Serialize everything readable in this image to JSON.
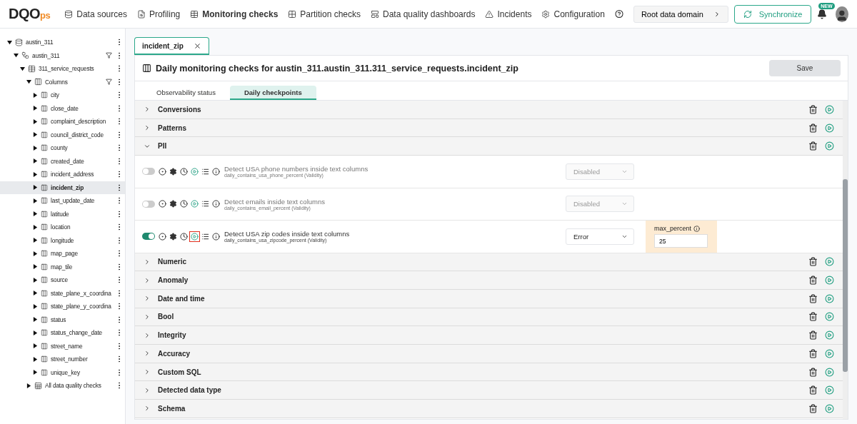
{
  "logo": {
    "main": "DQO",
    "suffix": "ps"
  },
  "nav": [
    {
      "label": "Data sources",
      "kind": "sources",
      "selected": false
    },
    {
      "label": "Profiling",
      "kind": "profiling",
      "selected": false
    },
    {
      "label": "Monitoring checks",
      "kind": "monitoring",
      "selected": true
    },
    {
      "label": "Partition checks",
      "kind": "partition",
      "selected": false
    },
    {
      "label": "Data quality dashboards",
      "kind": "dashboards",
      "selected": false
    },
    {
      "label": "Incidents",
      "kind": "incidents",
      "selected": false
    },
    {
      "label": "Configuration",
      "kind": "configuration",
      "selected": false
    }
  ],
  "header_right": {
    "domain_button": "Root data domain",
    "sync_button": "Synchronize",
    "badge": "NEW"
  },
  "tree": [
    {
      "label": "austin_311",
      "kind": "database",
      "expanded": true,
      "selected": false,
      "children": [
        {
          "label": "austin_311",
          "kind": "schema",
          "expanded": true,
          "selected": false,
          "children": [
            {
              "label": "311_service_requests",
              "kind": "table",
              "expanded": true,
              "selected": false,
              "children": [
                {
                  "label": "Columns",
                  "kind": "columns",
                  "expanded": true,
                  "selected": false,
                  "children": [
                    {
                      "label": "city",
                      "kind": "column",
                      "expanded": false,
                      "selected": false
                    },
                    {
                      "label": "close_date",
                      "kind": "column",
                      "expanded": false,
                      "selected": false
                    },
                    {
                      "label": "complaint_description",
                      "kind": "column",
                      "expanded": false,
                      "selected": false
                    },
                    {
                      "label": "council_district_code",
                      "kind": "column",
                      "expanded": false,
                      "selected": false
                    },
                    {
                      "label": "county",
                      "kind": "column",
                      "expanded": false,
                      "selected": false
                    },
                    {
                      "label": "created_date",
                      "kind": "column",
                      "expanded": false,
                      "selected": false
                    },
                    {
                      "label": "incident_address",
                      "kind": "column",
                      "expanded": false,
                      "selected": false
                    },
                    {
                      "label": "incident_zip",
                      "kind": "column",
                      "expanded": false,
                      "selected": true
                    },
                    {
                      "label": "last_update_date",
                      "kind": "column",
                      "expanded": false,
                      "selected": false
                    },
                    {
                      "label": "latitude",
                      "kind": "column",
                      "expanded": false,
                      "selected": false
                    },
                    {
                      "label": "location",
                      "kind": "column",
                      "expanded": false,
                      "selected": false
                    },
                    {
                      "label": "longitude",
                      "kind": "column",
                      "expanded": false,
                      "selected": false
                    },
                    {
                      "label": "map_page",
                      "kind": "column",
                      "expanded": false,
                      "selected": false
                    },
                    {
                      "label": "map_tile",
                      "kind": "column",
                      "expanded": false,
                      "selected": false
                    },
                    {
                      "label": "source",
                      "kind": "column",
                      "expanded": false,
                      "selected": false
                    },
                    {
                      "label": "state_plane_x_coordina",
                      "kind": "column",
                      "expanded": false,
                      "selected": false
                    },
                    {
                      "label": "state_plane_y_coordina",
                      "kind": "column",
                      "expanded": false,
                      "selected": false
                    },
                    {
                      "label": "status",
                      "kind": "column",
                      "expanded": false,
                      "selected": false
                    },
                    {
                      "label": "status_change_date",
                      "kind": "column",
                      "expanded": false,
                      "selected": false
                    },
                    {
                      "label": "street_name",
                      "kind": "column",
                      "expanded": false,
                      "selected": false
                    },
                    {
                      "label": "street_number",
                      "kind": "column",
                      "expanded": false,
                      "selected": false
                    },
                    {
                      "label": "unique_key",
                      "kind": "column",
                      "expanded": false,
                      "selected": false
                    }
                  ]
                },
                {
                  "label": "All data quality checks",
                  "kind": "checks",
                  "expanded": false,
                  "selected": false
                }
              ]
            }
          ]
        }
      ]
    }
  ],
  "open_tabs": [
    {
      "label": "incident_zip",
      "selected": true
    }
  ],
  "panel": {
    "title": "Daily monitoring checks for austin_311.austin_311.311_service_requests.incident_zip",
    "save_button": "Save",
    "subtabs": [
      {
        "label": "Observability status",
        "selected": false
      },
      {
        "label": "Daily checkpoints",
        "selected": true
      }
    ],
    "categories": [
      {
        "name": "Conversions",
        "expanded": false
      },
      {
        "name": "Patterns",
        "expanded": false
      },
      {
        "name": "PII",
        "expanded": true,
        "checks": [
          {
            "title": "Detect USA phone numbers inside text columns",
            "subtitle": "daily_contains_usa_phone_percent (Validity)",
            "enabled": false,
            "severity": "Disabled",
            "run_highlighted": false
          },
          {
            "title": "Detect emails inside text columns",
            "subtitle": "daily_contains_email_percent (Validity)",
            "enabled": false,
            "severity": "Disabled",
            "run_highlighted": false
          },
          {
            "title": "Detect USA zip codes inside text columns",
            "subtitle": "daily_contains_usa_zipcode_percent (Validity)",
            "enabled": true,
            "severity": "Error",
            "run_highlighted": true,
            "parameter": {
              "label": "max_percent",
              "value": "25"
            }
          }
        ]
      },
      {
        "name": "Numeric",
        "expanded": false
      },
      {
        "name": "Anomaly",
        "expanded": false
      },
      {
        "name": "Date and time",
        "expanded": false
      },
      {
        "name": "Bool",
        "expanded": false
      },
      {
        "name": "Integrity",
        "expanded": false
      },
      {
        "name": "Accuracy",
        "expanded": false
      },
      {
        "name": "Custom SQL",
        "expanded": false
      },
      {
        "name": "Detected data type",
        "expanded": false
      },
      {
        "name": "Schema",
        "expanded": false
      }
    ]
  }
}
